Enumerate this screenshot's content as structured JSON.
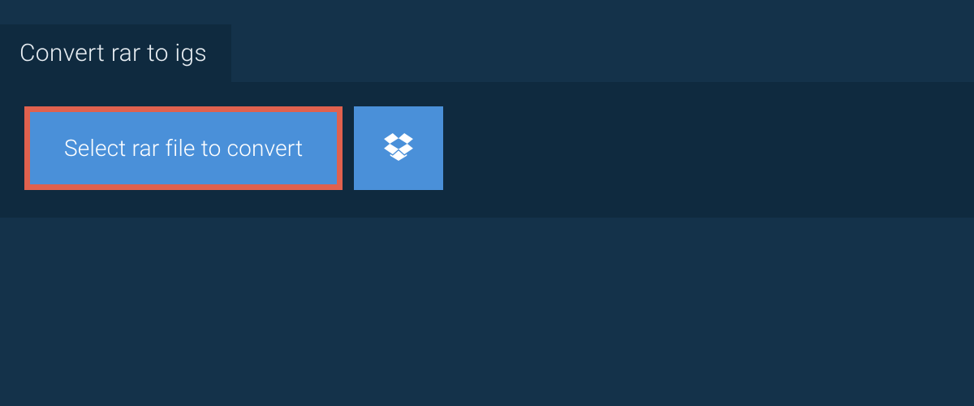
{
  "header": {
    "tab_label": "Convert rar to igs"
  },
  "actions": {
    "select_file_label": "Select rar file to convert",
    "dropbox_icon": "dropbox-icon"
  },
  "colors": {
    "page_bg": "#14324a",
    "panel_bg": "#0f2a3f",
    "button_bg": "#4a90d9",
    "highlight_border": "#e0614e",
    "text_light": "#ffffff"
  }
}
